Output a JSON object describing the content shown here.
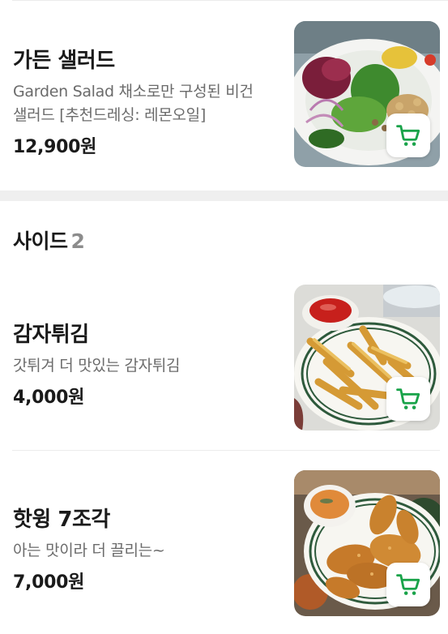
{
  "colors": {
    "accent_green": "#1aa34a",
    "price_text": "#1a1a1a",
    "desc_text": "#6b6b6b",
    "count_text": "#8c8c8c"
  },
  "items_top": [
    {
      "name": "가든 샐러드",
      "description": "Garden Salad 채소로만 구성된 비건 샐러드  [추천드레싱: 레몬오일]",
      "price": "12,900원",
      "image_icon": "salad-photo",
      "cart_icon": "cart-icon"
    }
  ],
  "side_section": {
    "title": "사이드",
    "count": "2"
  },
  "side_items": [
    {
      "name": "감자튀김",
      "description": "갓튀겨 더 맛있는 감자튀김",
      "price": "4,000원",
      "image_icon": "fries-photo",
      "cart_icon": "cart-icon"
    },
    {
      "name": "핫윙 7조각",
      "description": "아는 맛이라 더 끌리는~",
      "price": "7,000원",
      "image_icon": "wings-photo",
      "cart_icon": "cart-icon"
    }
  ]
}
